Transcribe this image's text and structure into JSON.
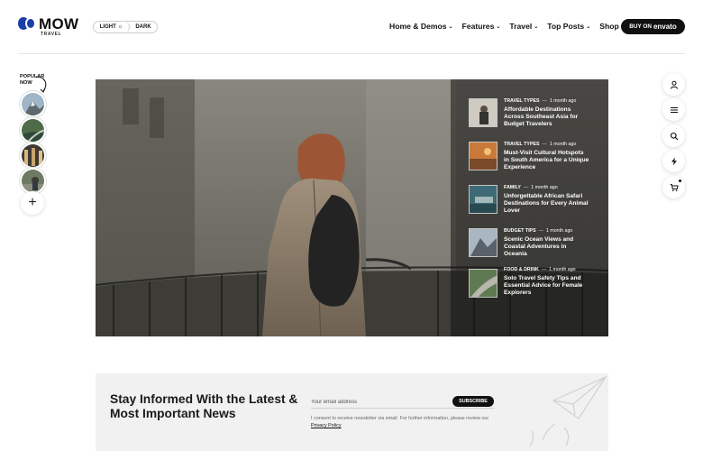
{
  "brand": {
    "name": "MOW",
    "subtitle": "TRAVEL",
    "accent": "#1b3ea8"
  },
  "mode": {
    "light": "LIGHT",
    "dark": "DARK",
    "active": "light"
  },
  "nav": [
    {
      "label": "Home & Demos"
    },
    {
      "label": "Features"
    },
    {
      "label": "Travel"
    },
    {
      "label": "Top Posts"
    },
    {
      "label": "Shop"
    }
  ],
  "buy": {
    "prefix": "BUY ON",
    "brand": "envato"
  },
  "popular": {
    "label_line1": "POPULAR",
    "label_line2": "NOW",
    "add_icon": "plus-icon"
  },
  "tools": [
    "user-icon",
    "menu-icon",
    "search-icon",
    "bolt-icon",
    "cart-icon"
  ],
  "stories": [
    {
      "category": "TRAVEL TYPES",
      "time": "1 month ago",
      "title": "Affordable Destinations Across Southeast Asia for Budget Travelers"
    },
    {
      "category": "TRAVEL TYPES",
      "time": "1 month ago",
      "title": "Must-Visit Cultural Hotspots in South America for a Unique Experience"
    },
    {
      "category": "FAMILY",
      "time": "1 month ago",
      "title": "Unforgettable African Safari Destinations for Every Animal Lover"
    },
    {
      "category": "BUDGET TIPS",
      "time": "1 month ago",
      "title": "Scenic Ocean Views and Coastal Adventures in Oceania"
    },
    {
      "category": "FOOD & DRINK",
      "time": "1 month ago",
      "title": "Solo Travel Safety Tips and Essential Advice for Female Explorers"
    }
  ],
  "newsletter": {
    "title": "Stay Informed With the Latest & Most Important News",
    "placeholder": "Your email address",
    "button": "SUBSCRIBE",
    "consent": "I consent to receive newsletter via email. For further information, please review our",
    "policy": "Privacy Policy"
  }
}
